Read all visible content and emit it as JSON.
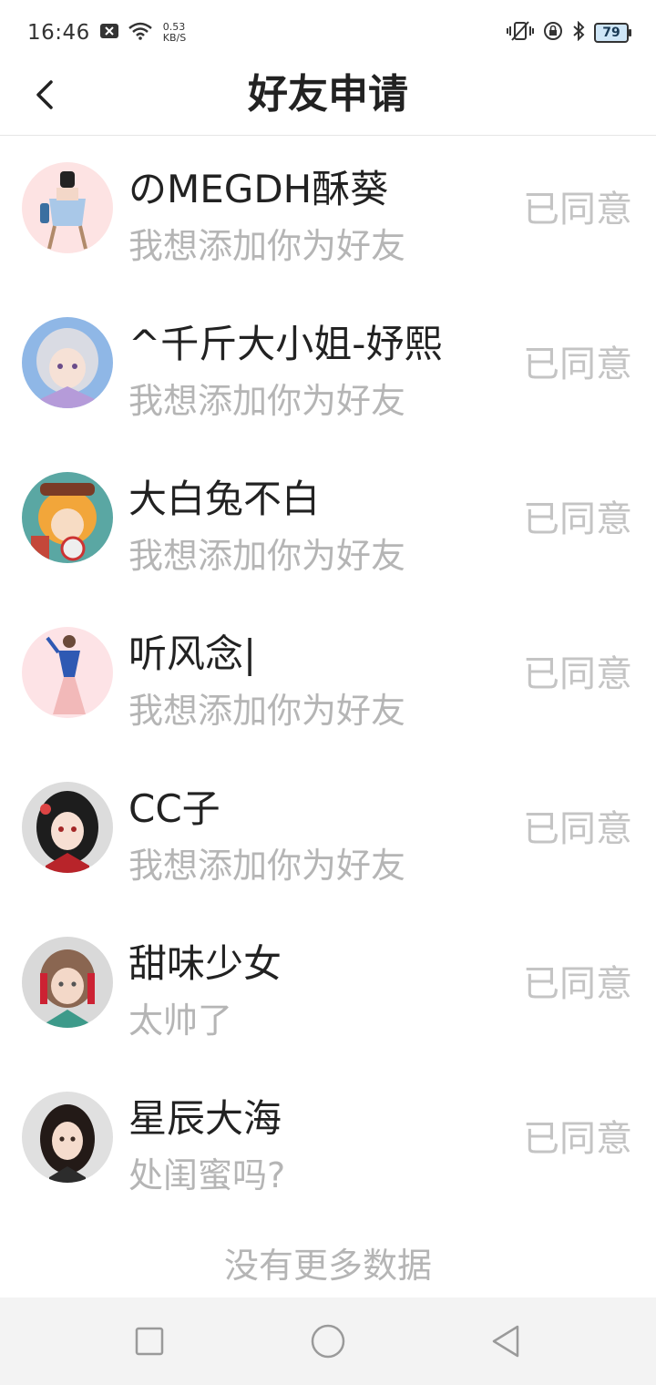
{
  "status_bar": {
    "time": "16:46",
    "speed_value": "0.53",
    "speed_unit": "KB/S",
    "battery": "79",
    "icons": [
      "notification-close-icon",
      "wifi-icon",
      "vibrate-icon",
      "rotation-lock-icon",
      "bluetooth-icon",
      "battery-icon"
    ]
  },
  "header": {
    "title": "好友申请",
    "back_icon": "chevron-left-icon"
  },
  "requests": [
    {
      "name": "のMEGDH酥葵",
      "message": "我想添加你为好友",
      "status": "已同意"
    },
    {
      "name": "^千斤大小姐-妤熙",
      "message": "我想添加你为好友",
      "status": "已同意"
    },
    {
      "name": "大白兔不白",
      "message": "我想添加你为好友",
      "status": "已同意"
    },
    {
      "name": "听风念|",
      "message": "我想添加你为好友",
      "status": "已同意"
    },
    {
      "name": "CC子",
      "message": "我想添加你为好友",
      "status": "已同意"
    },
    {
      "name": "甜味少女",
      "message": "太帅了",
      "status": "已同意"
    },
    {
      "name": "星辰大海",
      "message": "处闺蜜吗?",
      "status": "已同意"
    }
  ],
  "footer_text": "没有更多数据",
  "nav_bar": {
    "icons": [
      "recent-apps-icon",
      "home-icon",
      "back-icon"
    ]
  },
  "colors": {
    "status_text": "#c4c4c4",
    "secondary_text": "#b5b5b5",
    "nav_background": "#f3f3f3"
  }
}
